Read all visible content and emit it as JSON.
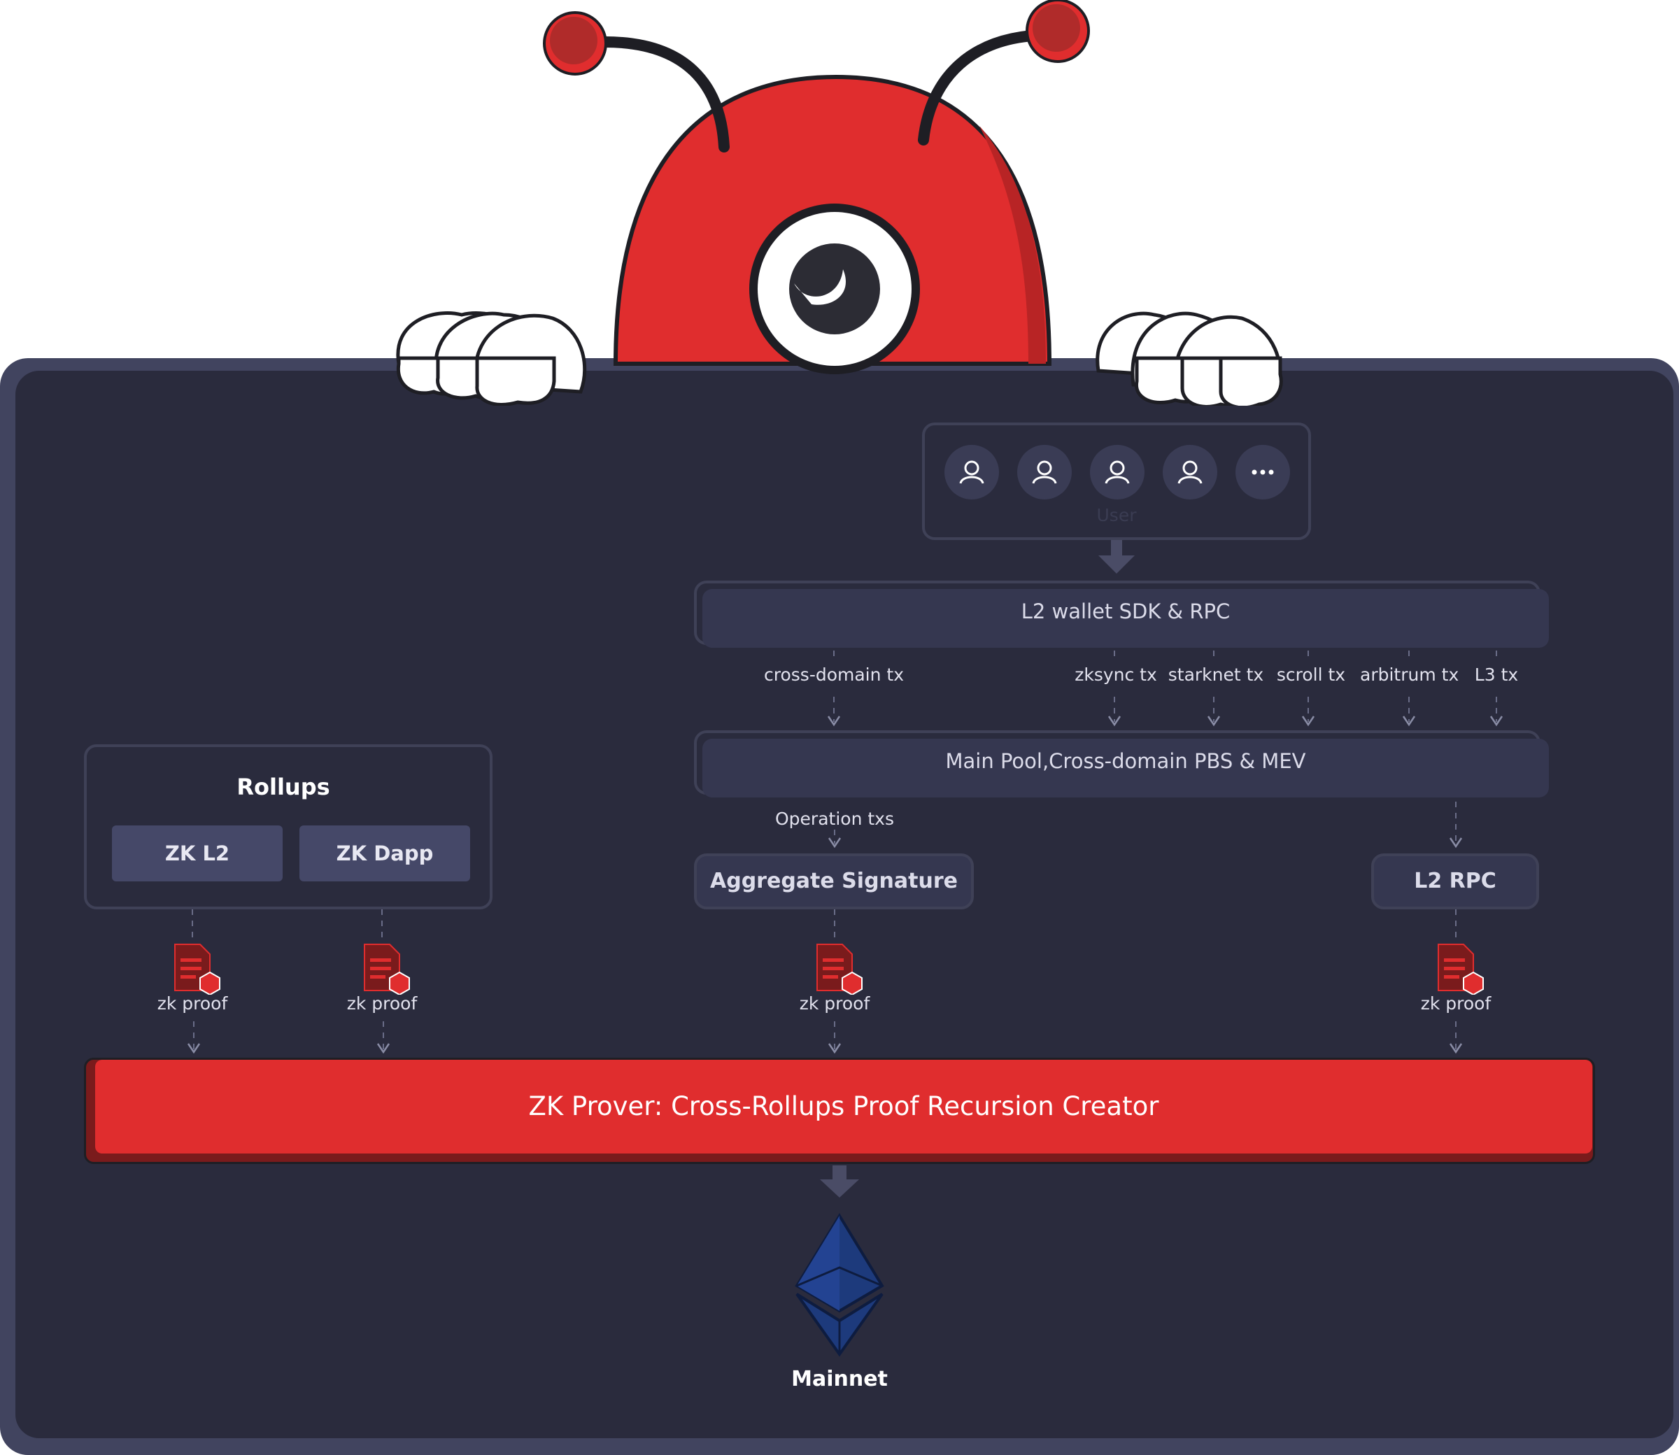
{
  "users": {
    "items": [
      "user-icon",
      "user-icon",
      "user-icon",
      "user-icon",
      "more-icon"
    ],
    "label": "User"
  },
  "wallet": {
    "label": "L2 wallet SDK & RPC"
  },
  "tx_labels": {
    "cross_domain": "cross-domain tx",
    "zksync": "zksync tx",
    "starknet": "starknet tx",
    "scroll": "scroll tx",
    "arbitrum": "arbitrum tx",
    "l3": "L3 tx"
  },
  "pool": {
    "label": "Main Pool,Cross-domain PBS & MEV"
  },
  "operation_label": "Operation txs",
  "aggregate": {
    "label": "Aggregate Signature"
  },
  "l2rpc": {
    "label": "L2 RPC"
  },
  "rollups": {
    "title": "Rollups",
    "items": [
      "ZK L2",
      "ZK Dapp"
    ]
  },
  "proof_label": "zk proof",
  "prover": {
    "label": "ZK Prover: Cross-Rollups Proof Recursion Creator"
  },
  "mainnet": {
    "label": "Mainnet"
  },
  "colors": {
    "mascot_red": "#e02d2e",
    "panel_dark": "#2a2b3d",
    "panel_border": "#41445f",
    "ethereum_blue": "#1f3a8a"
  }
}
